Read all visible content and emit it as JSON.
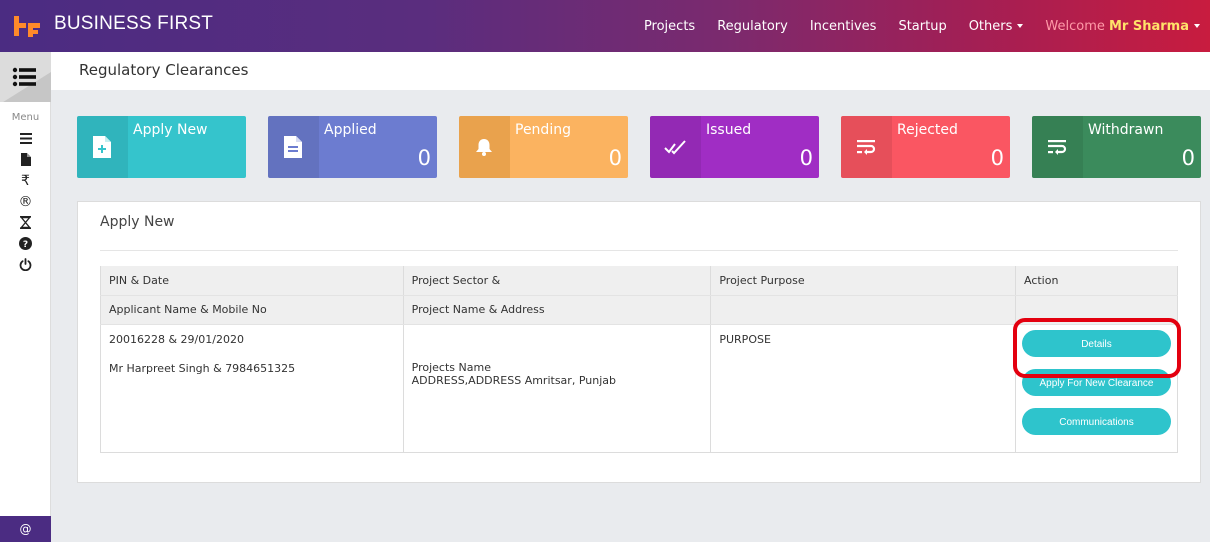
{
  "header": {
    "brand": "BUSINESS FIRST",
    "nav": [
      {
        "label": "Projects"
      },
      {
        "label": "Regulatory"
      },
      {
        "label": "Incentives"
      },
      {
        "label": "Startup"
      },
      {
        "label": "Others"
      }
    ],
    "welcome_prefix": "Welcome",
    "user_name": "Mr Sharma"
  },
  "sidebar": {
    "menu_label": "Menu",
    "icons": [
      "list-icon",
      "file-icon",
      "rupee-icon",
      "registered-icon",
      "hourglass-icon",
      "question-icon",
      "power-icon"
    ],
    "bottom_label": "@"
  },
  "page": {
    "title": "Regulatory Clearances"
  },
  "cards": [
    {
      "label": "Apply New",
      "count": "",
      "color": "#35c4cc",
      "icon": "file-plus-icon"
    },
    {
      "label": "Applied",
      "count": "0",
      "color": "#6c7cd0",
      "icon": "document-icon"
    },
    {
      "label": "Pending",
      "count": "0",
      "color": "#fbb360",
      "icon": "bell-icon"
    },
    {
      "label": "Issued",
      "count": "0",
      "color": "#a02dc4",
      "icon": "double-check-icon"
    },
    {
      "label": "Rejected",
      "count": "0",
      "color": "#fa5662",
      "icon": "wrap-icon"
    },
    {
      "label": "Withdrawn",
      "count": "0",
      "color": "#3b8b5c",
      "icon": "wrap-icon"
    }
  ],
  "panel": {
    "title": "Apply New",
    "columns": [
      {
        "line1": "PIN & Date",
        "line2": "Applicant Name & Mobile No"
      },
      {
        "line1": "Project Sector &",
        "line2": "Project Name & Address"
      },
      {
        "line1": "Project Purpose",
        "line2": ""
      },
      {
        "line1": "Action",
        "line2": ""
      }
    ],
    "row": {
      "pin_date": "20016228 & 29/01/2020",
      "applicant": "Mr Harpreet Singh & 7984651325",
      "project_name": "Projects Name",
      "project_address": "ADDRESS,ADDRESS Amritsar, Punjab",
      "purpose": "PURPOSE",
      "actions": [
        "Details",
        "Apply For New Clearance",
        "Communications"
      ]
    }
  }
}
